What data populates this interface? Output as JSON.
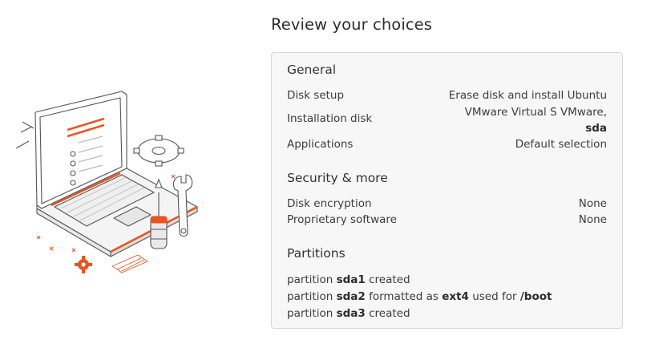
{
  "title": "Review your choices",
  "general": {
    "heading": "General",
    "disk_setup_label": "Disk setup",
    "disk_setup_value": "Erase disk and install Ubuntu",
    "installation_disk_label": "Installation disk",
    "installation_disk_value_line1": "VMware Virtual S VMware,",
    "installation_disk_value_line2": "sda",
    "applications_label": "Applications",
    "applications_value": "Default selection"
  },
  "security": {
    "heading": "Security & more",
    "disk_encryption_label": "Disk encryption",
    "disk_encryption_value": "None",
    "proprietary_label": "Proprietary software",
    "proprietary_value": "None"
  },
  "partitions": {
    "heading": "Partitions",
    "word_partition": "partition",
    "p1_name": "sda1",
    "p1_action": "created",
    "p2_name": "sda2",
    "p2_formatted": "formatted as",
    "p2_fs": "ext4",
    "p2_used_for": "used for",
    "p2_mount": "/boot",
    "p3_name": "sda3",
    "p3_action": "created"
  },
  "colors": {
    "accent": "#e95420",
    "text": "#3d3d3d",
    "card_bg": "#f7f7f7",
    "card_border": "#d8d8d8"
  }
}
